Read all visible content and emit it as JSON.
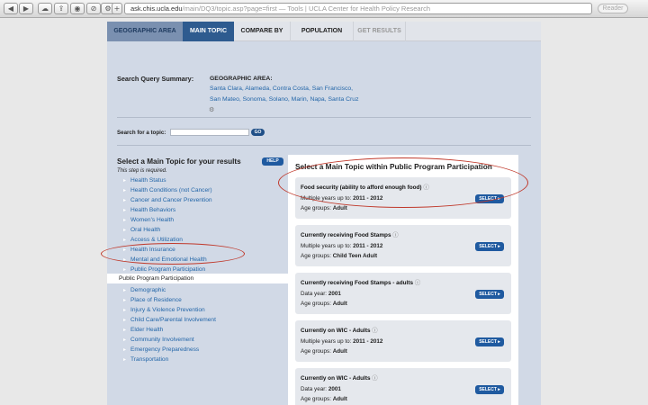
{
  "browser": {
    "url_host": "ask.chis.ucla.edu",
    "url_rest": "/main/DQ3/topic.asp?page=first — Tools | UCLA Center for Health Policy Research",
    "reader_label": "Reader"
  },
  "tabs": [
    {
      "label": "GEOGRAPHIC AREA"
    },
    {
      "label": "MAIN TOPIC"
    },
    {
      "label": "COMPARE BY"
    },
    {
      "label": "POPULATION"
    },
    {
      "label": "GET RESULTS"
    }
  ],
  "summary": {
    "label": "Search Query Summary:",
    "geo_label": "GEOGRAPHIC AREA:",
    "geo_line1": "Santa Clara, Alameda, Contra Costa, San Francisco,",
    "geo_line2": "San Mateo, Sonoma, Solano, Marin, Napa, Santa Cruz"
  },
  "search": {
    "label": "Search for a topic:",
    "value": "",
    "go_label": "GO"
  },
  "left": {
    "title": "Select a Main Topic for your results",
    "subtitle": "This step is required.",
    "help_label": "HELP",
    "topics": [
      "Health Status",
      "Health Conditions (not Cancer)",
      "Cancer and Cancer Prevention",
      "Health Behaviors",
      "Women's Health",
      "Oral Health",
      "Access & Utilization",
      "Health Insurance",
      "Mental and Emotional Health",
      "Public Program Participation",
      "Demographic",
      "Place of Residence",
      "Injury & Violence Prevention",
      "Child Care/Parental Involvement",
      "Elder Health",
      "Community Involvement",
      "Emergency Preparedness",
      "Transportation"
    ],
    "sub_topic": "Public Program Participation"
  },
  "right": {
    "title": "Select a Main Topic within Public Program Participation",
    "select_label": "SELECT ▸",
    "cards": [
      {
        "title": "Food security (ability to afford enough food)",
        "line1_label": "Multiple years up to:",
        "line1_value": "2011 - 2012",
        "line2_label": "Age groups:",
        "line2_value": "Adult"
      },
      {
        "title": "Currently receiving Food Stamps",
        "line1_label": "Multiple years up to:",
        "line1_value": "2011 - 2012",
        "line2_label": "Age groups:",
        "line2_value": "Child Teen Adult"
      },
      {
        "title": "Currently receiving Food Stamps - adults",
        "line1_label": "Data year:",
        "line1_value": "2001",
        "line2_label": "Age groups:",
        "line2_value": "Adult"
      },
      {
        "title": "Currently on WIC - Adults",
        "line1_label": "Multiple years up to:",
        "line1_value": "2011 - 2012",
        "line2_label": "Age groups:",
        "line2_value": "Adult"
      },
      {
        "title": "Currently on WIC - Adults",
        "line1_label": "Data year:",
        "line1_value": "2001",
        "line2_label": "Age groups:",
        "line2_value": "Adult"
      }
    ]
  },
  "colors": {
    "accent": "#2e5b8f",
    "link": "#2366a8",
    "panel": "#d1d9e6",
    "highlight_oval": "#c0392b"
  }
}
